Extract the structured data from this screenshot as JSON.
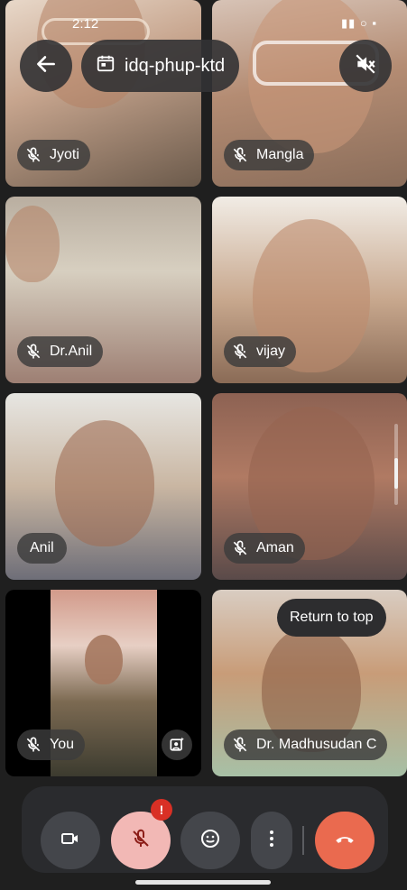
{
  "status_bar": {
    "time": "2:12",
    "icons": "▮▮ ○ ▪"
  },
  "header": {
    "back_icon": "arrow-left-icon",
    "meeting_code": "idq-phup-ktd",
    "calendar_icon": "calendar-icon",
    "speaker_icon": "speaker-off-icon"
  },
  "participants": [
    {
      "name": "Jyoti",
      "muted": true
    },
    {
      "name": "Mangla",
      "muted": true
    },
    {
      "name": "Dr.Anil",
      "muted": true
    },
    {
      "name": "vijay",
      "muted": true
    },
    {
      "name": "Anil",
      "muted": false
    },
    {
      "name": "Aman",
      "muted": true
    },
    {
      "name": "You",
      "muted": true
    },
    {
      "name": "Dr. Madhusudan C",
      "muted": true
    }
  ],
  "return_to_top": "Return to top",
  "controls": {
    "camera_icon": "video-camera-icon",
    "mic_icon": "mic-off-icon",
    "mic_badge": "!",
    "emoji_icon": "emoji-icon",
    "more_icon": "more-vertical-icon",
    "end_call_icon": "end-call-icon"
  },
  "colors": {
    "end_call": "#ea6a4f",
    "mic_off_bg": "#f2b8b5",
    "badge": "#d93025",
    "bar_bg": "#2a2b2e"
  }
}
